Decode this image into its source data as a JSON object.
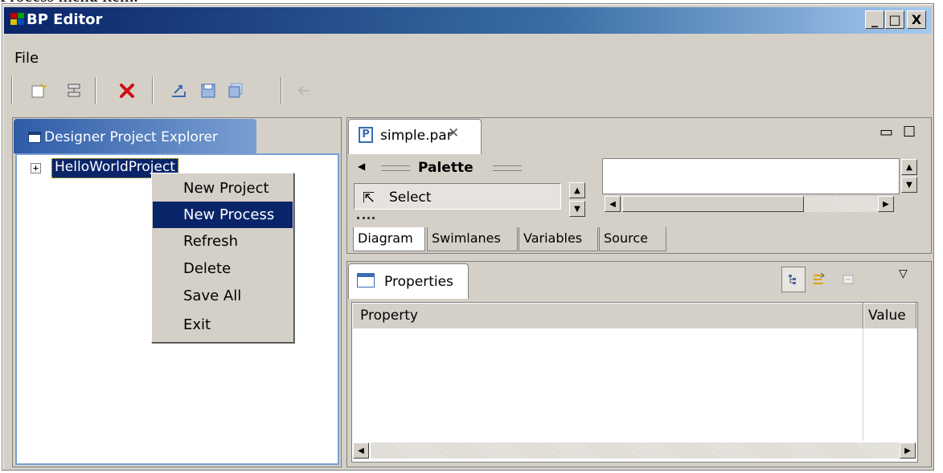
{
  "caption": "Process menu item.",
  "window": {
    "title": "BP Editor",
    "minimize_label": "_",
    "maximize_label": "□",
    "close_label": "X"
  },
  "menubar": {
    "file_label": "File"
  },
  "toolbar": {
    "icons": [
      "new-project-icon",
      "new-process-icon",
      "delete-icon",
      "export-icon",
      "save-icon",
      "save-all-icon",
      "back-icon"
    ]
  },
  "project_explorer": {
    "tab_label": "Designer Project Explorer",
    "tree_expander": "+",
    "tree_item": "HelloWorldProject"
  },
  "context_menu": {
    "items": [
      {
        "label": "New Project",
        "highlighted": false
      },
      {
        "label": "New Process",
        "highlighted": true
      },
      {
        "label": "Refresh",
        "highlighted": false
      },
      {
        "label": "Delete",
        "highlighted": false
      },
      {
        "label": "Save All",
        "highlighted": false
      },
      {
        "label": "Exit",
        "highlighted": false
      }
    ]
  },
  "editor": {
    "tab_label": "simple.par",
    "tab_icon_letter": "P",
    "palette_title": "Palette",
    "select_tool": "Select",
    "bottom_tabs": [
      "Diagram",
      "Swimlanes",
      "Variables",
      "Source"
    ],
    "active_bottom_tab": "Diagram"
  },
  "properties": {
    "tab_label": "Properties",
    "columns": [
      "Property",
      "Value"
    ]
  },
  "colors": {
    "titlebar_start": "#0a246a",
    "selection": "#0a246a",
    "window_bg": "#d4d0c8"
  }
}
